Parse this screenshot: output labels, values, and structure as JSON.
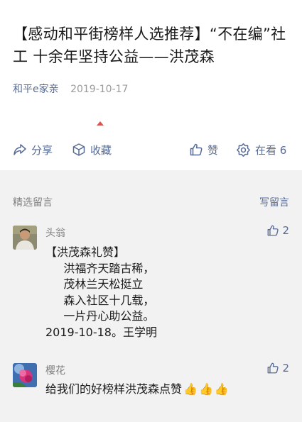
{
  "article": {
    "title": "【感动和平街榜样人选推荐】“不在编”社工 十余年坚持公益——洪茂森",
    "author": "和平e家亲",
    "date": "2019-10-17"
  },
  "actions": {
    "share": "分享",
    "favorite": "收藏",
    "like": "赞",
    "looking": "在看 6"
  },
  "comments_section": {
    "title": "精选留言",
    "write": "写留言",
    "items": [
      {
        "nickname": "头翁",
        "likes": "2",
        "text": "【洪茂森礼赞】\n     洪福齐天踏古稀，\n     茂林兰天松挺立\n     森入社区十几载，\n     一片丹心助公益。\n2019-10-18。王学明"
      },
      {
        "nickname": "樱花",
        "likes": "2",
        "text": "给我们的好榜样洪茂森点赞",
        "emoji": "👍👍👍"
      }
    ]
  },
  "colors": {
    "link": "#576b95",
    "gray_text": "#7f7f7f",
    "comments_bg": "#f2f2f2"
  }
}
